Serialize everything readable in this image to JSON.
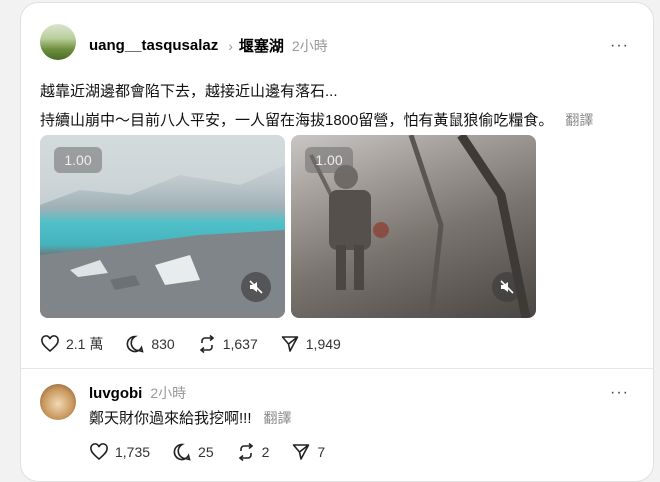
{
  "post": {
    "username": "uang__tasqusalaz",
    "chevron": "›",
    "topic": "堰塞湖",
    "time": "2小時",
    "more": "···",
    "line1": "越靠近湖邊都會陷下去，越接近山邊有落石...",
    "line2": "持續山崩中～目前八人平安，一人留在海拔1800留營，怕有黃鼠狼偷吃糧食。",
    "translate": "翻譯",
    "media": [
      {
        "speed": "1.00",
        "icon": "speaker-muted-icon"
      },
      {
        "speed": "1.00",
        "icon": "speaker-muted-icon"
      }
    ],
    "actions": {
      "likes": "2.1 萬",
      "comments": "830",
      "reposts": "1,637",
      "shares": "1,949"
    }
  },
  "reply": {
    "username": "luvgobi",
    "time": "2小時",
    "more": "···",
    "text": "鄭天財你過來給我挖啊!!!",
    "translate": "翻譯",
    "actions": {
      "likes": "1,735",
      "comments": "25",
      "reposts": "2",
      "shares": "7"
    }
  },
  "icons": [
    "heart-icon",
    "comment-icon",
    "repost-icon",
    "share-icon",
    "more-icon"
  ]
}
